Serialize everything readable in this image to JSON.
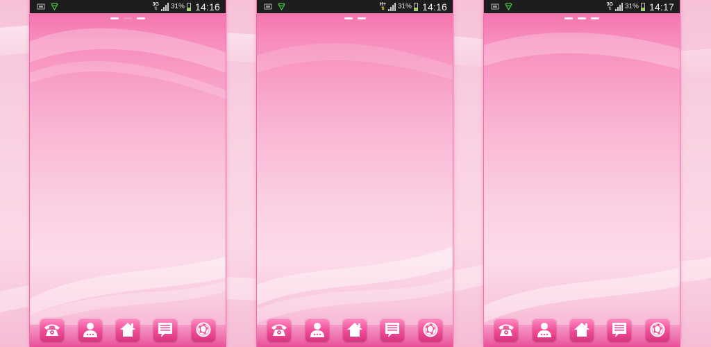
{
  "colors": {
    "accent": "#f04c98",
    "status_bar": "#1d1d1d",
    "battery_fill": "#8fd444"
  },
  "screens": [
    {
      "status": {
        "left_icons": [
          "screenshot-icon",
          "shield-icon"
        ],
        "network": "3G",
        "battery_percent": "31%",
        "time": "14:16"
      },
      "page_indicator": {
        "count": 3,
        "active_index": 1
      }
    },
    {
      "status": {
        "left_icons": [
          "screenshot-icon",
          "shield-icon"
        ],
        "network": "H+",
        "battery_percent": "31%",
        "time": "14:16"
      },
      "page_indicator": {
        "count": 2,
        "active_index": 0
      }
    },
    {
      "status": {
        "left_icons": [
          "screenshot-icon",
          "shield-icon"
        ],
        "network": "3G",
        "battery_percent": "31%",
        "time": "14:17"
      },
      "page_indicator": {
        "count": 3,
        "active_index": 0
      }
    }
  ],
  "dock": {
    "icons": [
      "phone-icon",
      "contacts-icon",
      "home-icon",
      "messages-icon",
      "browser-icon"
    ]
  }
}
